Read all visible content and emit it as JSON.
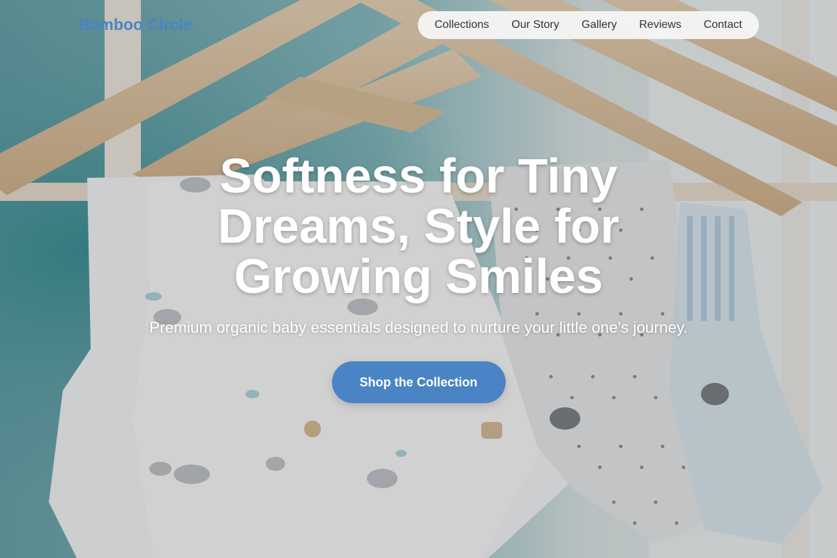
{
  "header": {
    "logo_text": "Bamboo Circle",
    "nav_items": [
      {
        "label": "Collections"
      },
      {
        "label": "Our Story"
      },
      {
        "label": "Gallery"
      },
      {
        "label": "Reviews"
      },
      {
        "label": "Contact"
      }
    ]
  },
  "hero": {
    "title_line1": "Softness for Tiny",
    "title_line2": "Dreams, Style for",
    "title_line3": "Growing Smiles",
    "subtitle": "Premium organic baby essentials designed to nurture your little one's journey.",
    "cta_label": "Shop the Collection",
    "background_image": "baby-clothes-on-wooden-hangers"
  },
  "colors": {
    "brand": "#4a84c4",
    "nav_bg": "#f5f5f5",
    "nav_text": "#333333",
    "hero_text": "#ffffff",
    "backdrop_teal": "#6fa7ad"
  }
}
